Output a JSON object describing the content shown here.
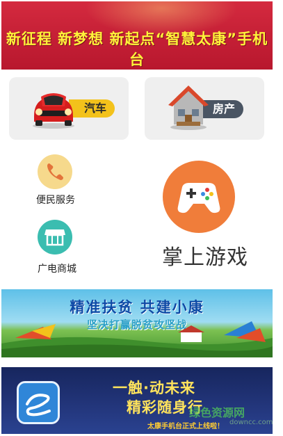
{
  "banner_top": {
    "text": "新征程 新梦想 新起点“智慧太康”手机台"
  },
  "tiles": {
    "car": {
      "label": "汽车"
    },
    "house": {
      "label": "房产"
    }
  },
  "services": {
    "convenience": {
      "label": "便民服务"
    },
    "mall": {
      "label": "广电商城"
    },
    "game": {
      "label": "掌上游戏"
    }
  },
  "banner_mid": {
    "title": "精准扶贫 共建小康",
    "subtitle": "坚决打赢脱贫攻坚战"
  },
  "banner_bot": {
    "line1": "一触·动未来",
    "line2": "精彩随身行",
    "notice": "太康手机台正式上线啦！"
  },
  "watermark": {
    "text": "绿色资源网",
    "url": "downcc.com"
  },
  "colors": {
    "accent_red": "#c41f35",
    "game_orange": "#f07d3a",
    "mall_teal": "#3bbdb0",
    "phone_yellow": "#f6d98c"
  }
}
